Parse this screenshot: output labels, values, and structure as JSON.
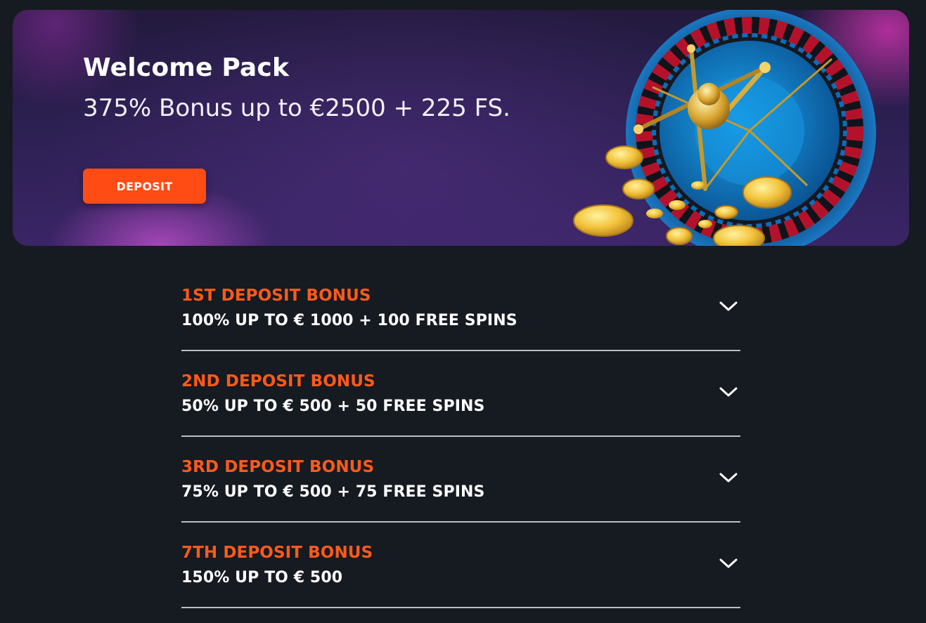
{
  "hero": {
    "title": "Welcome Pack",
    "subtitle": "375% Bonus up to €2500 + 225 FS.",
    "deposit_label": "DEPOSIT"
  },
  "colors": {
    "accent": "#ff4c14",
    "bonus_title": "#ff5a1a",
    "background": "#161a21",
    "divider": "#bcbfc5"
  },
  "bonuses": [
    {
      "title": "1ST DEPOSIT BONUS",
      "description": "100% UP TO € 1000 + 100 FREE SPINS",
      "icon": "chevron-down-icon"
    },
    {
      "title": "2ND DEPOSIT BONUS",
      "description": "50% UP TO € 500 + 50 FREE SPINS",
      "icon": "chevron-down-icon"
    },
    {
      "title": "3RD DEPOSIT BONUS",
      "description": "75% UP TO € 500 + 75 FREE SPINS",
      "icon": "chevron-down-icon"
    },
    {
      "title": "7TH DEPOSIT BONUS",
      "description": "150% UP TO € 500",
      "icon": "chevron-down-icon"
    }
  ]
}
